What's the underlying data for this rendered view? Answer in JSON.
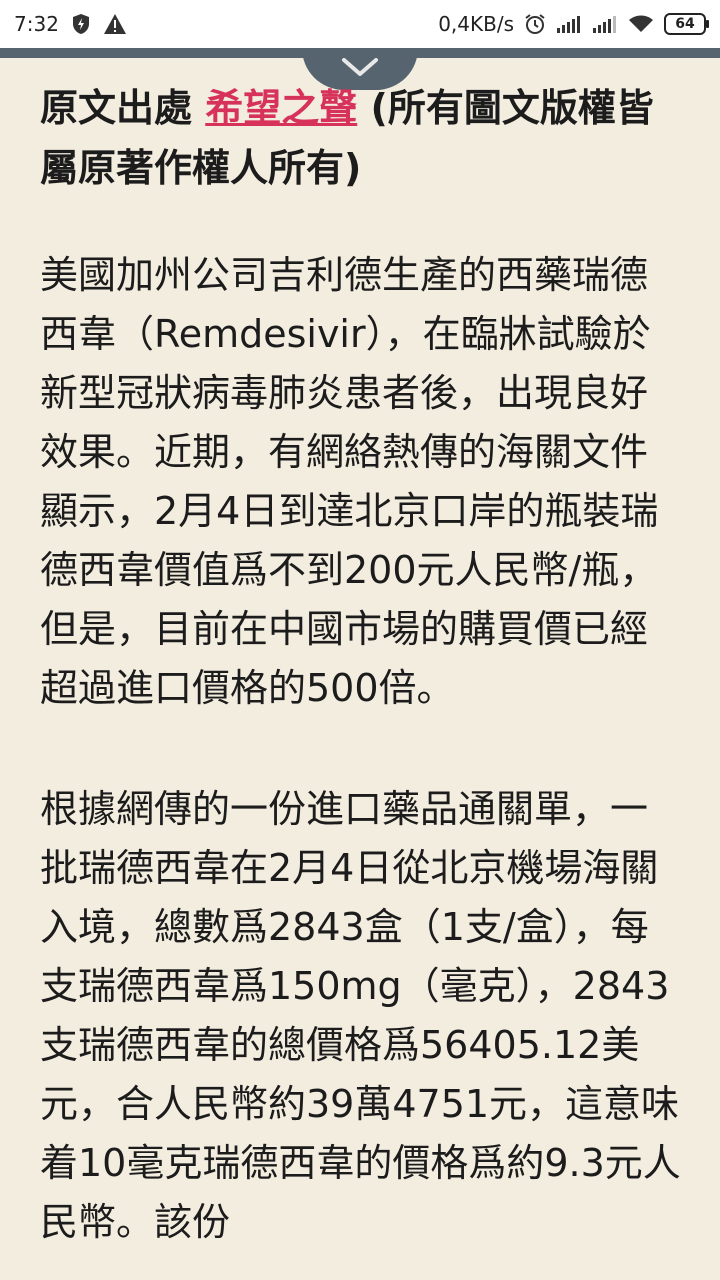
{
  "status_bar": {
    "time": "7:32",
    "network_speed": "0,4KB/s",
    "battery": "64",
    "icons": [
      "shield-bolt-icon",
      "warning-icon",
      "alarm-icon",
      "signal-icon",
      "signal-icon",
      "wifi-icon",
      "battery-icon"
    ]
  },
  "header": {
    "collapse_icon": "chevron-down-icon"
  },
  "article": {
    "source_prefix": "原文出處 ",
    "source_link": "希望之聲",
    "source_suffix": " (所有圖文版權皆屬原著作權人所有)",
    "paragraph_1": "美國加州公司吉利德生產的西藥瑞德西韋（Remdesivir），在臨牀試驗於新型冠狀病毒肺炎患者後，出現良好效果。近期，有網絡熱傳的海關文件顯示，2月4日到達北京口岸的瓶裝瑞德西韋價值爲不到200元人民幣/瓶，但是，目前在中國市場的購買價已經超過進口價格的500倍。",
    "paragraph_2": "根據網傳的一份進口藥品通關單，一批瑞德西韋在2月4日從北京機場海關入境，總數爲2843盒（1支/盒），每支瑞德西韋爲150mg（毫克），2843支瑞德西韋的總價格爲56405.12美元，合人民幣約39萬4751元，這意味着10毫克瑞德西韋的價格爲約9.3元人民幣。該份"
  },
  "colors": {
    "page_background": "#f3ede0",
    "link": "#d6325a",
    "header_tab": "#566470"
  }
}
